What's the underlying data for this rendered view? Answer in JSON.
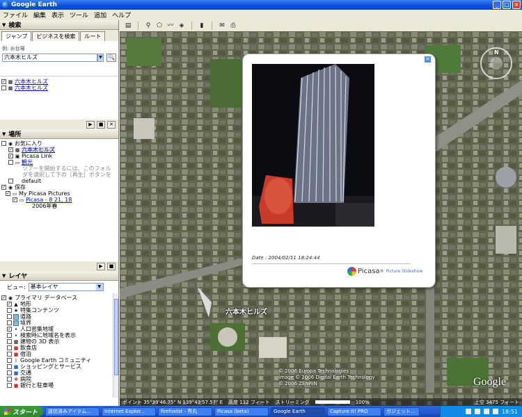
{
  "window": {
    "title": "Google Earth",
    "buttons": [
      "_",
      "□",
      "×"
    ]
  },
  "menu": [
    "ファイル",
    "編集",
    "表示",
    "ツール",
    "追加",
    "ヘルプ"
  ],
  "toolbar_icons": [
    "sidebar-icon",
    "placemark-icon",
    "polygon-icon",
    "path-icon",
    "overlay-icon",
    "ruler-icon",
    "email-icon",
    "print-icon"
  ],
  "search": {
    "header": "検索",
    "tabs": [
      "ジャンプ",
      "ビジネスを検索",
      "ルート"
    ],
    "hint": "例: お台場",
    "value": "六本木ヒルズ",
    "results": [
      "六本木ヒルズ",
      "六本木ヒルズ"
    ]
  },
  "places": {
    "header": "場所",
    "items": [
      {
        "label": "お気に入り",
        "style": "normal"
      },
      {
        "label": "六本木ヒルズ",
        "style": "link-selected"
      },
      {
        "label": "Picasa Link",
        "style": "normal"
      },
      {
        "label": "観光",
        "style": "link"
      },
      {
        "label": "ツアーを開始するには、このフォル",
        "style": "gray"
      },
      {
        "label": "ダを選択して下の［再生］ボタンを",
        "style": "gray"
      },
      {
        "label": "default",
        "style": "normal"
      },
      {
        "label": "保存",
        "style": "normal"
      },
      {
        "label": "My Picasa Pictures",
        "style": "normal"
      },
      {
        "label": "Picasa - 8 21, 18",
        "style": "link"
      },
      {
        "label": "2006年春",
        "style": "normal"
      }
    ]
  },
  "layers": {
    "header": "レイヤ",
    "view_label": "ビュー:",
    "view_value": "基本レイヤ",
    "items": [
      "プライマリ データベース",
      "地形",
      "特集コンテンツ",
      "道路",
      "境界",
      "人口密集地域",
      "検索時に地域名を表示",
      "建物の 3D 表示",
      "飲食店",
      "宿泊",
      "Google Earth コミュニティ",
      "ショッピングとサービス",
      "交通",
      "病院",
      "銀行と駐車場"
    ]
  },
  "balloon": {
    "date": "Date : 2004/02/11 18:24:44",
    "brand": "Picasa",
    "brand_suffix": "®",
    "brand_sub": "Picture Slideshow"
  },
  "map": {
    "place_label": "六本木ヒルズ",
    "copyright": [
      "© 2006 Europa Technologies",
      "Image © 2006 Digital Earth Technology",
      "© 2006 ZENRIN"
    ],
    "logo": "Google",
    "compass_n": "N",
    "status": {
      "coords": "ポイント 35°39'46.75\" N 139°43'57.57\" E",
      "elev": "高度 112 フィート",
      "stream": "ストリーミング",
      "stream_pct": "100%",
      "eye": "上空  3475 フィート"
    }
  },
  "taskbar": {
    "start": "スタート",
    "tasks": [
      "送信済みアイテム...",
      "Internet Explor...",
      "firefoxtst - 秀丸",
      "Picasa (beta)",
      "Google Earth",
      "Capture It! PRO",
      "ガジェット..."
    ],
    "clock": "18:51"
  }
}
